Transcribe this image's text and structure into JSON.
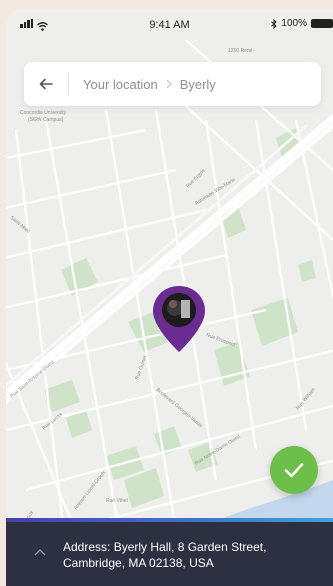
{
  "status_bar": {
    "time": "9:41 AM",
    "battery": "100%"
  },
  "search": {
    "crumbs": [
      "Your location",
      "Byerly"
    ]
  },
  "map": {
    "labels": {
      "top": "1250 René-",
      "concordia": "Concordia University\n(SGW Campus)",
      "saint_marc": "Saint-Marc",
      "rue_argyle": "Rue Argyle",
      "autoroute": "Autoroute Ville-Marie",
      "rue_prospect": "Rue Prospect",
      "rue_guinet": "Rue Guinet",
      "beaumont": "Boulevard Georges-Vanier",
      "rue_saint_antoine": "Rue Saint-Antoine Ouest",
      "rue_lucas": "Rue Lucas",
      "rue_notre_dame": "Rue Notre-Dame Ouest",
      "rue_william": "Rue William",
      "rue_vinet": "Rue Vinet",
      "saint_jacques": "Avenue Lionel-Groulx",
      "grand_trunk": "Rue Guy"
    }
  },
  "bottom_sheet": {
    "address": "Address:  Byerly Hall, 8 Garden Street, Cambridge, MA 02138, USA"
  },
  "colors": {
    "pin": "#6a2c91",
    "confirm": "#6cc04a",
    "sheet": "#2d3040"
  }
}
